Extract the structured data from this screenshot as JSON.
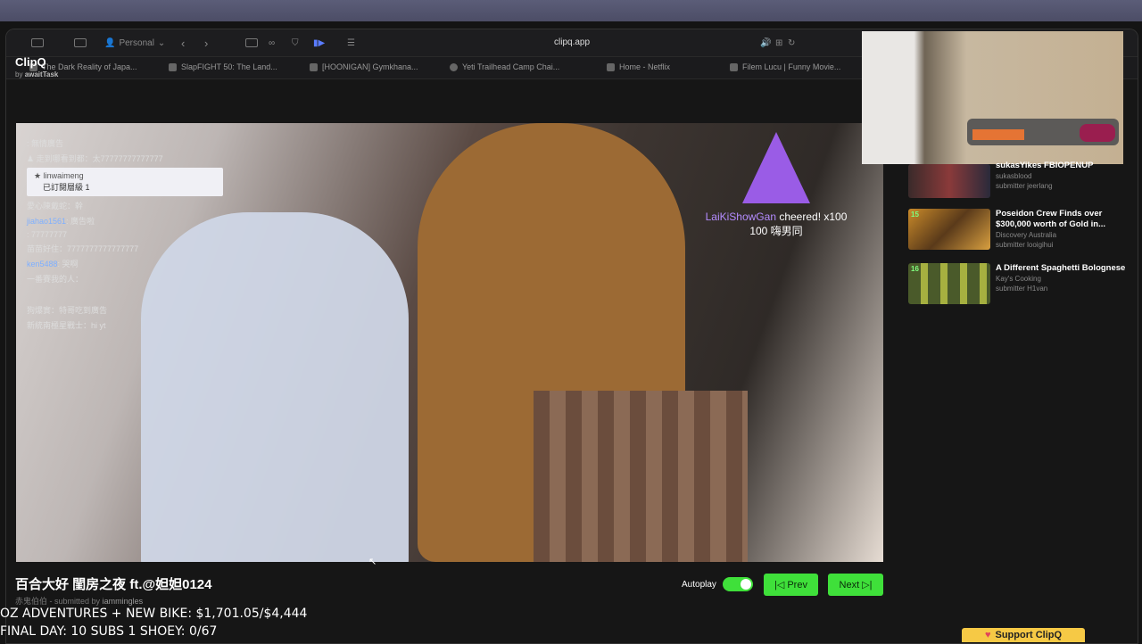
{
  "browser": {
    "profile": "Personal",
    "url": "clipq.app",
    "tabs": [
      "The Dark Reality of Japa...",
      "SlapFIGHT 50: The Land...",
      "[HOONIGAN] Gymkhana...",
      "Yeti Trailhead Camp Chai...",
      "Home - Netflix",
      "Filem Lucu | Funny Movie..."
    ]
  },
  "app": {
    "name": "ClipQ",
    "by_prefix": "by",
    "by_user": "awaitTask"
  },
  "chat": {
    "lines": [
      {
        "user": "",
        "msg": ": 無情廣告"
      },
      {
        "user": "",
        "msg": "♟ 走到哪看到都：太77777777777777"
      },
      {
        "user": "",
        "msg": "愛心陳戴蛇：幹"
      },
      {
        "user": "jiahao1561",
        "msg": ": 廣告啦"
      },
      {
        "user": "",
        "msg": ": 77777777"
      },
      {
        "user": "",
        "msg": "苗苗好住：7777777777777777"
      },
      {
        "user": "ken5488",
        "msg": ": 哭啊"
      },
      {
        "user": "",
        "msg": "一番賽我的人："
      },
      {
        "user": "",
        "msg": "狗爆實：特哥吃到廣告"
      },
      {
        "user": "",
        "msg": "新統南極星戰士：hi yt"
      }
    ],
    "highlight_user": "linwaimeng",
    "highlight_msg": "已訂閱層級 1"
  },
  "cheer": {
    "user": "LaiKiShowGan",
    "text": " cheered! x100",
    "line2": "100 嗨男同"
  },
  "video": {
    "title": "百合大好 閨房之夜 ft.@妲妲0124",
    "channel": "赤鬼伯伯",
    "submitted_prefix": "- submitted by",
    "submitter": "iammingles"
  },
  "controls": {
    "autoplay_label": "Autoplay",
    "prev_label": "Prev",
    "next_label": "Next"
  },
  "sidebar": [
    {
      "num": "",
      "title": "sukasYikes FBIOPENUP",
      "channel": "sukasblood",
      "submitter": "submitter jeerlang"
    },
    {
      "num": "15",
      "title": "Poseidon Crew Finds over $300,000 worth of Gold in...",
      "channel": "Discovery Australia",
      "submitter": "submitter looigihui"
    },
    {
      "num": "16",
      "title": "A Different Spaghetti Bolognese",
      "channel": "Kay's Cooking",
      "submitter": "submitter H1van"
    }
  ],
  "overlay": {
    "line1": "OZ ADVENTURES + NEW BIKE: $1,701.05/$4,444",
    "line2": "FINAL DAY: 10 SUBS 1 SHOEY: 0/67"
  },
  "support_label": "Support ClipQ",
  "colors": {
    "accent": "#3fe03a",
    "support": "#f6c945"
  }
}
